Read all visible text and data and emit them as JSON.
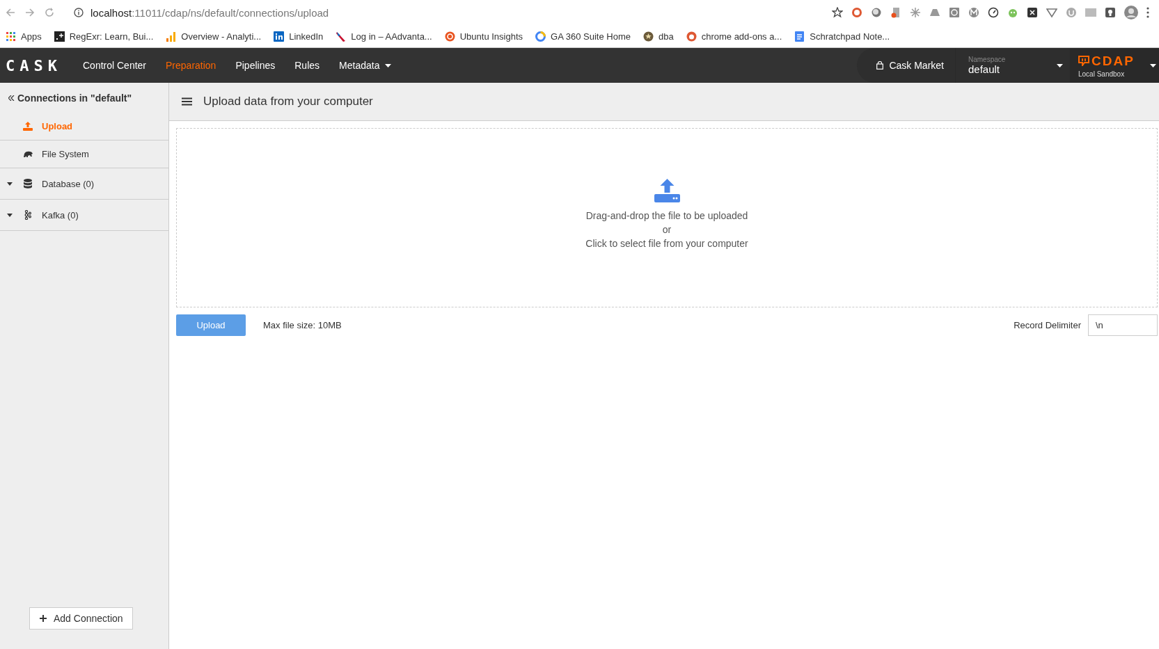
{
  "browser": {
    "url_host": "localhost",
    "url_path": ":11011/cdap/ns/default/connections/upload",
    "bookmarks": [
      {
        "label": "Apps",
        "kind": "apps"
      },
      {
        "label": "RegExr: Learn, Bui...",
        "kind": "regex"
      },
      {
        "label": "Overview - Analyti...",
        "kind": "analytics"
      },
      {
        "label": "LinkedIn",
        "kind": "linkedin"
      },
      {
        "label": "Log in – AAdvanta...",
        "kind": "airline"
      },
      {
        "label": "Ubuntu Insights",
        "kind": "ubuntu"
      },
      {
        "label": "GA 360 Suite Home",
        "kind": "ga"
      },
      {
        "label": "dba",
        "kind": "badge"
      },
      {
        "label": "chrome add-ons a...",
        "kind": "duck"
      },
      {
        "label": "Schratchpad Note...",
        "kind": "doc"
      }
    ]
  },
  "navbar": {
    "logo": "CASK",
    "items": [
      {
        "label": "Control Center",
        "selected": false,
        "has_menu": false
      },
      {
        "label": "Preparation",
        "selected": true,
        "has_menu": false
      },
      {
        "label": "Pipelines",
        "selected": false,
        "has_menu": false
      },
      {
        "label": "Rules",
        "selected": false,
        "has_menu": false
      },
      {
        "label": "Metadata",
        "selected": false,
        "has_menu": true
      }
    ],
    "market": "Cask Market",
    "namespace_label": "Namespace",
    "namespace": "default",
    "product": "CDAP",
    "instance": "Local Sandbox"
  },
  "sidebar": {
    "title": "Connections in \"default\"",
    "items": [
      {
        "label": "Upload",
        "kind": "upload",
        "selected": true,
        "has_toggle": false
      },
      {
        "label": "File System",
        "kind": "filesystem",
        "selected": false,
        "has_toggle": false
      },
      {
        "label": "Database (0)",
        "kind": "database",
        "selected": false,
        "has_toggle": true
      },
      {
        "label": "Kafka (0)",
        "kind": "kafka",
        "selected": false,
        "has_toggle": true
      }
    ],
    "add_button": "Add Connection"
  },
  "main": {
    "title": "Upload data from your computer",
    "dropzone": [
      "Drag-and-drop the file to be uploaded",
      "or",
      "Click to select file from your computer"
    ],
    "upload_button": "Upload",
    "max_size": "Max file size: 10MB",
    "delimiter_label": "Record Delimiter",
    "delimiter_value": "\\n"
  }
}
